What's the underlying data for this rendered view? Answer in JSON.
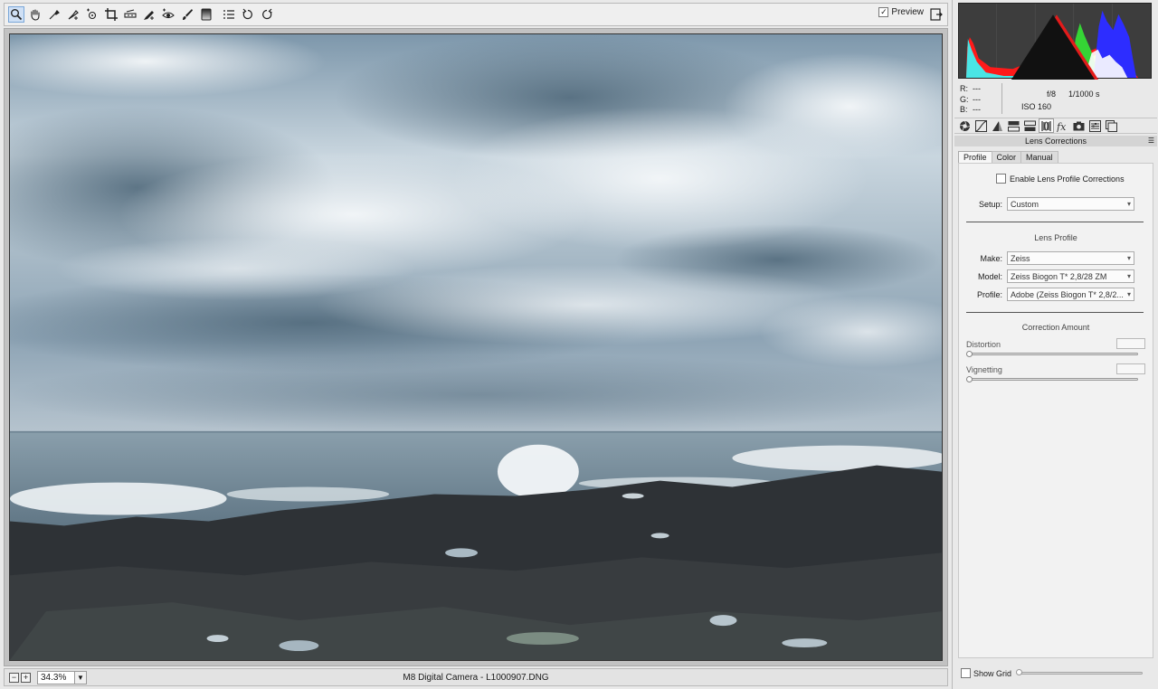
{
  "toolbar": {
    "tools": [
      {
        "name": "zoom-tool",
        "icon": "magnifier-icon",
        "active": true
      },
      {
        "name": "hand-tool",
        "icon": "hand-icon"
      },
      {
        "name": "white-balance-tool",
        "icon": "eyedropper-icon"
      },
      {
        "name": "color-sampler-tool",
        "icon": "eyedropper-plus-icon"
      },
      {
        "name": "targeted-adjustment-tool",
        "icon": "target-icon"
      },
      {
        "name": "crop-tool",
        "icon": "crop-icon"
      },
      {
        "name": "straighten-tool",
        "icon": "level-icon"
      },
      {
        "name": "spot-removal-tool",
        "icon": "brush-plus-icon"
      },
      {
        "name": "red-eye-tool",
        "icon": "eye-icon"
      },
      {
        "name": "adjustment-brush-tool",
        "icon": "brush-icon"
      },
      {
        "name": "graduated-filter-tool",
        "icon": "gradient-icon"
      },
      {
        "name": "preferences-button",
        "icon": "list-icon"
      },
      {
        "name": "rotate-left-button",
        "icon": "rotate-ccw-icon"
      },
      {
        "name": "rotate-right-button",
        "icon": "rotate-cw-icon"
      }
    ],
    "preview_label": "Preview",
    "preview_checked": true
  },
  "status": {
    "zoom_value": "34.3%",
    "file_title": "M8 Digital Camera  -  L1000907.DNG"
  },
  "readout": {
    "r_label": "R:",
    "r_value": "---",
    "g_label": "G:",
    "g_value": "---",
    "b_label": "B:",
    "b_value": "---",
    "aperture": "f/8",
    "shutter": "1/1000 s",
    "iso": "ISO 160"
  },
  "panel": {
    "title": "Lens Corrections",
    "tabs": [
      {
        "name": "basic",
        "icon": "aperture-icon"
      },
      {
        "name": "tone-curve",
        "icon": "curve-icon"
      },
      {
        "name": "detail",
        "icon": "triangle-icon"
      },
      {
        "name": "hsl",
        "icon": "hsl-icon"
      },
      {
        "name": "split-toning",
        "icon": "split-icon"
      },
      {
        "name": "lens-corrections",
        "icon": "lens-icon",
        "active": true
      },
      {
        "name": "effects",
        "icon": "fx-icon"
      },
      {
        "name": "camera-calibration",
        "icon": "camera-icon"
      },
      {
        "name": "presets",
        "icon": "sliders-icon"
      },
      {
        "name": "snapshots",
        "icon": "snapshot-icon"
      }
    ],
    "subtabs": [
      "Profile",
      "Color",
      "Manual"
    ],
    "enable_label": "Enable Lens Profile Corrections",
    "setup_label": "Setup:",
    "setup_value": "Custom",
    "lens_profile_title": "Lens Profile",
    "make_label": "Make:",
    "make_value": "Zeiss",
    "model_label": "Model:",
    "model_value": "Zeiss Biogon T* 2,8/28 ZM",
    "profile_label": "Profile:",
    "profile_value": "Adobe (Zeiss Biogon T* 2,8/2...",
    "correction_title": "Correction Amount",
    "distortion_label": "Distortion",
    "vignetting_label": "Vignetting",
    "show_grid_label": "Show Grid"
  },
  "colors": {
    "hist_red": "#ff1a1a",
    "hist_green": "#35d435",
    "hist_blue": "#2d2dff",
    "hist_cyan": "#40f0f0",
    "hist_yellow": "#f0f020"
  }
}
